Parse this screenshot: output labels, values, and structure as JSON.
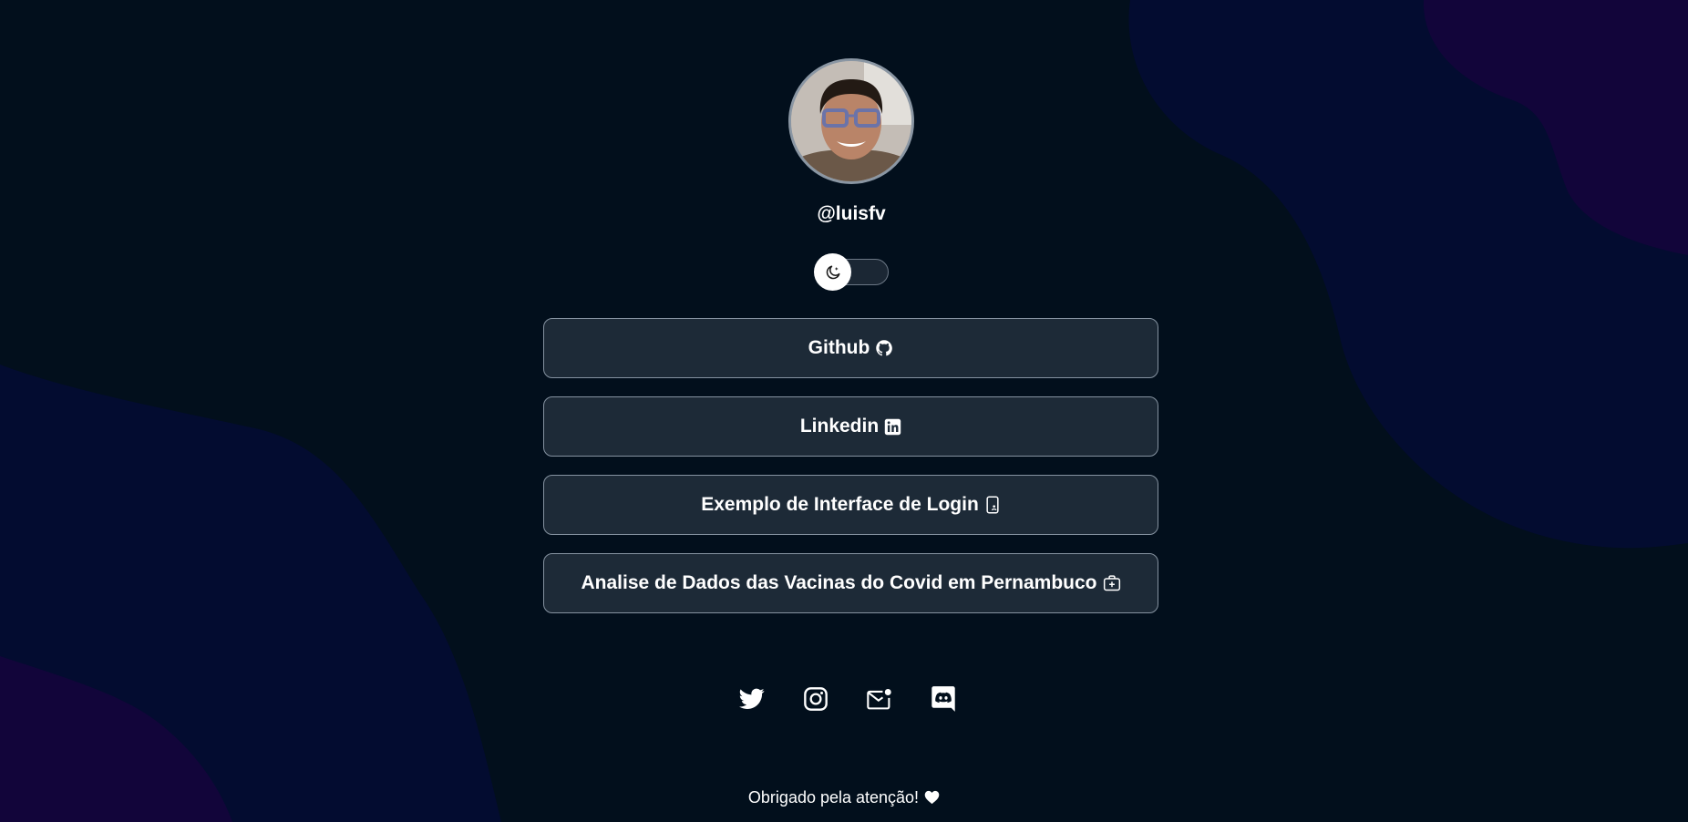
{
  "profile": {
    "username": "@luisfv",
    "avatar_alt": "profile photo"
  },
  "theme_toggle": {
    "state": "dark",
    "icon": "moon-stars-icon"
  },
  "links": [
    {
      "label": "Github",
      "icon": "github-icon"
    },
    {
      "label": "Linkedin",
      "icon": "linkedin-icon"
    },
    {
      "label": "Exemplo de Interface de Login",
      "icon": "phone-login-icon"
    },
    {
      "label": "Analise de Dados das Vacinas do Covid em Pernambuco",
      "icon": "medical-case-icon"
    }
  ],
  "socials": [
    {
      "name": "twitter",
      "icon": "twitter-icon"
    },
    {
      "name": "instagram",
      "icon": "instagram-icon"
    },
    {
      "name": "email",
      "icon": "email-icon"
    },
    {
      "name": "discord",
      "icon": "discord-icon"
    }
  ],
  "footer": {
    "text": "Obrigado pela atenção!",
    "icon": "heart-icon"
  },
  "colors": {
    "background": "#020f1c",
    "button_bg": "#1d2a37",
    "button_border": "#8592a0",
    "blob_navy": "#030c30",
    "blob_purple": "#12053a"
  }
}
